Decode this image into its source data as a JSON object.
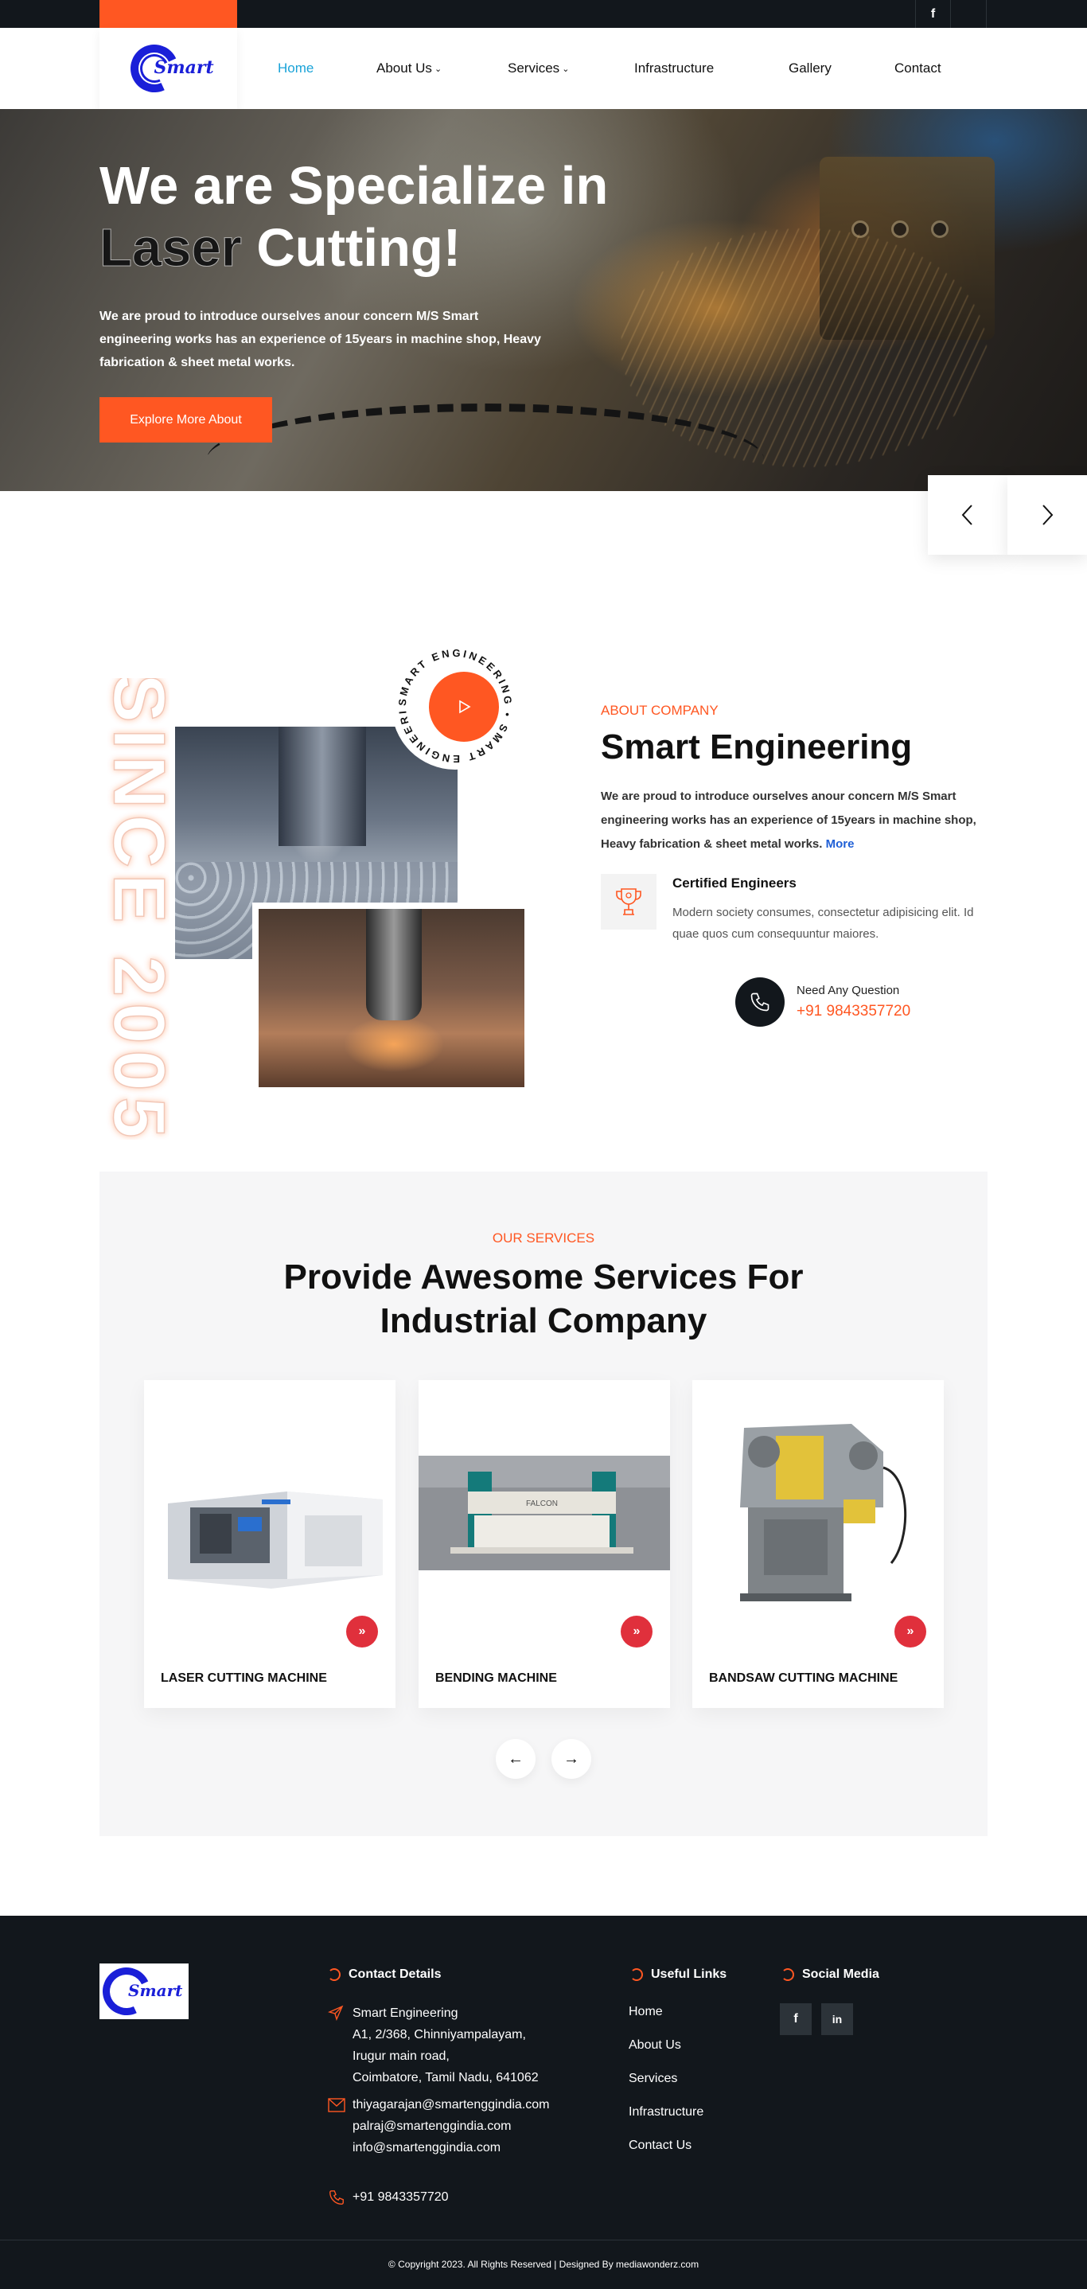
{
  "topbar": {
    "facebook_icon": "facebook-icon"
  },
  "header": {
    "logo_text": "Smart",
    "nav": [
      {
        "label": "Home"
      },
      {
        "label": "About Us"
      },
      {
        "label": "Services"
      },
      {
        "label": "Infrastructure"
      },
      {
        "label": "Gallery"
      },
      {
        "label": "Contact"
      }
    ]
  },
  "hero": {
    "title_line1": "We are Specialize in",
    "title_line2_dark": "Laser",
    "title_line2_light": "Cutting!",
    "text": "We are proud to introduce ourselves anour concern M/S Smart engineering works has an experience of 15years in machine shop, Heavy fabrication & sheet metal works.",
    "button": "Explore More About",
    "prev_icon": "chevron-left-icon",
    "next_icon": "chevron-right-icon"
  },
  "about": {
    "since": "SINCE 2005",
    "badge_text": "SMART ENGINEERING • SMART ENGINEERING •",
    "tag": "ABOUT COMPANY",
    "title": "Smart Engineering",
    "text": "We are proud to introduce ourselves anour concern M/S Smart engineering works has an experience of 15years in machine shop, Heavy fabrication & sheet metal works.",
    "more": "More",
    "cert_title": "Certified Engineers",
    "cert_text": "Modern society consumes, consectetur adipisicing elit. Id quae quos cum consequuntur maiores.",
    "need_question": "Need Any Question",
    "phone": "+91 9843357720"
  },
  "services": {
    "tag": "OUR SERVICES",
    "title_line1": "Provide Awesome Services For",
    "title_line2": "Industrial Company",
    "cards": [
      {
        "name": "LASER CUTTING MACHINE"
      },
      {
        "name": "BENDING MACHINE"
      },
      {
        "name": "BANDSAW CUTTING MACHINE"
      }
    ]
  },
  "footer": {
    "contact_heading": "Contact Details",
    "company": "Smart Engineering",
    "address_line1": "A1, 2/368, Chinniyampalayam,",
    "address_line2": "Irugur main road,",
    "address_line3": "Coimbatore, Tamil Nadu, 641062",
    "email1": "thiyagarajan@smartenggindia.com",
    "email2": "palraj@smartenggindia.com",
    "email3": "info@smartenggindia.com",
    "phone": "+91 9843357720",
    "links_heading": "Useful Links",
    "links": [
      {
        "label": "Home"
      },
      {
        "label": "About Us"
      },
      {
        "label": "Services"
      },
      {
        "label": "Infrastructure"
      },
      {
        "label": "Contact Us"
      }
    ],
    "social_heading": "Social Media",
    "copyright": "© Copyright 2023. All Rights Reserved | Designed By mediawonderz.com"
  },
  "colors": {
    "accent": "#ff5722",
    "dark": "#12171c",
    "nav_active": "#1aa3d8",
    "brand_blue": "#1a1fd8",
    "card_arrow": "#e0303c"
  }
}
